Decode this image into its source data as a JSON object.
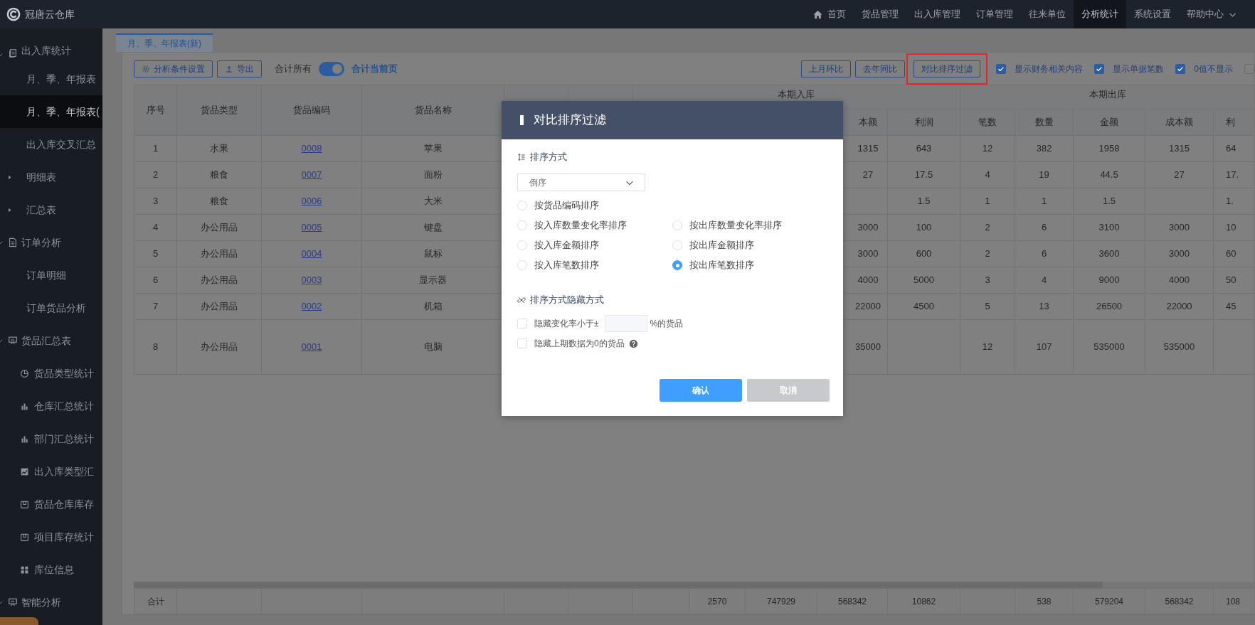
{
  "app": {
    "logo_text": "冠唐云仓库"
  },
  "top_nav": [
    {
      "label": "首页",
      "kind": "home",
      "selected": false
    },
    {
      "label": "货品管理",
      "kind": "plain",
      "selected": false
    },
    {
      "label": "出入库管理",
      "kind": "plain",
      "selected": false
    },
    {
      "label": "订单管理",
      "kind": "plain",
      "selected": false
    },
    {
      "label": "往来单位",
      "kind": "plain",
      "selected": false
    },
    {
      "label": "分析统计",
      "kind": "plain",
      "selected": true
    },
    {
      "label": "系统设置",
      "kind": "plain",
      "selected": false
    },
    {
      "label": "帮助中心",
      "kind": "dropdown",
      "selected": false
    }
  ],
  "sidebar": {
    "groups": [
      {
        "label": "出入库统计",
        "kind": "document",
        "expanded": true,
        "children": [
          {
            "label": "月、季、年报表",
            "selected": false
          },
          {
            "label": "月、季、年报表(",
            "selected": true
          },
          {
            "label": "出入库交叉汇总",
            "selected": false
          },
          {
            "label": "明细表",
            "selected": false,
            "expanded": false
          },
          {
            "label": "汇总表",
            "selected": false,
            "expanded": false
          }
        ]
      },
      {
        "label": "订单分析",
        "kind": "file",
        "expanded": true,
        "children": [
          {
            "label": "订单明细",
            "selected": false
          },
          {
            "label": "订单货品分析",
            "selected": false
          }
        ]
      },
      {
        "label": "货品汇总表",
        "kind": "board",
        "expanded": true,
        "children": [
          {
            "label": "货品类型统计",
            "kind": "pie",
            "selected": false
          },
          {
            "label": "仓库汇总统计",
            "kind": "bar",
            "selected": false
          },
          {
            "label": "部门汇总统计",
            "kind": "bar",
            "selected": false
          },
          {
            "label": "出入库类型汇",
            "kind": "area",
            "selected": false
          },
          {
            "label": "货品仓库库存",
            "kind": "box",
            "selected": false
          },
          {
            "label": "项目库存统计",
            "kind": "box",
            "selected": false
          },
          {
            "label": "库位信息",
            "kind": "grid",
            "selected": false
          }
        ]
      },
      {
        "label": "智能分析",
        "kind": "board",
        "expanded": true
      }
    ]
  },
  "tabs": [
    {
      "label": "月、季、年报表(新)",
      "selected": true
    }
  ],
  "toolbar": {
    "left_buttons": [
      {
        "label": "分析条件设置",
        "kind": "gear"
      },
      {
        "label": "导出",
        "kind": "upload"
      }
    ],
    "sum_toggle": {
      "off_label": "合计所有",
      "on_label": "合计当前页",
      "on": true
    },
    "right_buttons": [
      {
        "label": "上月环比",
        "highlighted": false
      },
      {
        "label": "去年同比",
        "highlighted": false
      },
      {
        "label": "对比排序过滤",
        "highlighted": true
      }
    ],
    "checkboxes": [
      {
        "label": "显示财务相关内容",
        "checked": true
      },
      {
        "label": "显示单据笔数",
        "checked": true
      },
      {
        "label": "0值不显示",
        "checked": true
      },
      {
        "checked": false
      }
    ]
  },
  "table": {
    "fixed_columns": [
      "序号",
      "货品类型",
      "货品编码",
      "货品名称"
    ],
    "groups": [
      {
        "label": "本期入库",
        "columns": [
          "本额",
          "利润"
        ]
      },
      {
        "label": "本期出库",
        "columns": [
          "笔数",
          "数量",
          "金额",
          "成本额",
          "利"
        ]
      }
    ],
    "rows": [
      {
        "cells": [
          "1",
          "水果",
          "0008",
          "苹果",
          "1315",
          "643",
          "12",
          "382",
          "1958",
          "1315",
          "64"
        ]
      },
      {
        "cells": [
          "2",
          "粮食",
          "0007",
          "面粉",
          "27",
          "17.5",
          "4",
          "19",
          "44.5",
          "27",
          "17."
        ]
      },
      {
        "cells": [
          "3",
          "粮食",
          "0006",
          "大米",
          null,
          "1.5",
          "1",
          "1",
          "1.5",
          null,
          "1."
        ]
      },
      {
        "cells": [
          "4",
          "办公用品",
          "0005",
          "键盘",
          "3000",
          "100",
          "2",
          "6",
          "3100",
          "3000",
          "10"
        ]
      },
      {
        "cells": [
          "5",
          "办公用品",
          "0004",
          "鼠标",
          "3000",
          "600",
          "2",
          "6",
          "3600",
          "3000",
          "60"
        ]
      },
      {
        "cells": [
          "6",
          "办公用品",
          "0003",
          "显示器",
          "4000",
          "5000",
          "3",
          "4",
          "9000",
          "4000",
          "50"
        ]
      },
      {
        "cells": [
          "7",
          "办公用品",
          "0002",
          "机箱",
          "22000",
          "4500",
          "5",
          "13",
          "26500",
          "22000",
          "45"
        ]
      },
      {
        "cells": [
          "8",
          "办公用品",
          "0001",
          "电脑",
          "35000",
          null,
          "12",
          "107",
          "535000",
          "535000",
          null
        ]
      }
    ],
    "footer": {
      "label": "合计",
      "cells": [
        null,
        null,
        null,
        null,
        null,
        null,
        "2570",
        "747929",
        "568342",
        "10862",
        null,
        "538",
        "579204",
        "568342",
        "108"
      ]
    }
  },
  "dialog": {
    "title": "对比排序过滤",
    "sort_section": {
      "title": "排序方式",
      "order": "倒序",
      "options": [
        [
          {
            "label": "按货品编码排序",
            "selected": false
          }
        ],
        [
          {
            "label": "按入库数量变化率排序",
            "selected": false
          },
          {
            "label": "按出库数量变化率排序",
            "selected": false
          }
        ],
        [
          {
            "label": "按入库金额排序",
            "selected": false
          },
          {
            "label": "按出库金额排序",
            "selected": false
          }
        ],
        [
          {
            "label": "按入库笔数排序",
            "selected": false
          },
          {
            "label": "按出库笔数排序",
            "selected": true
          }
        ]
      ]
    },
    "hide_section": {
      "title": "排序方式隐藏方式",
      "options": [
        {
          "kind": "threshold",
          "label": "隐藏变化率小于±",
          "suffix": "%的货品",
          "checked": false
        },
        {
          "kind": "help",
          "label": "隐藏上期数据为0的货品",
          "checked": false
        }
      ]
    },
    "buttons": [
      {
        "label": "确认",
        "kind": "primary"
      },
      {
        "label": "取消",
        "kind": "secondary"
      }
    ]
  }
}
